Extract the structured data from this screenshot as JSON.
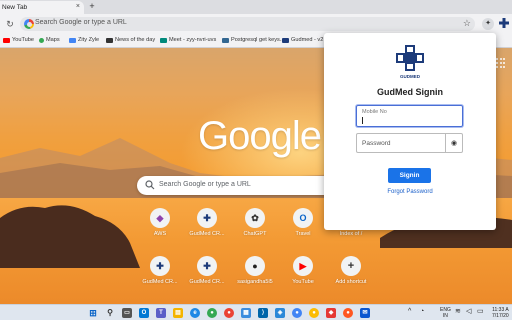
{
  "browser": {
    "tab_title": "New Tab",
    "tab_close": "×",
    "new_tab": "+",
    "omnibox_placeholder": "Search Google or type a URL",
    "bookmarks": [
      {
        "label": "YouTube",
        "color": "#ff0000"
      },
      {
        "label": "Maps",
        "color": "#34a853"
      },
      {
        "label": "Zity Zyle",
        "color": "#4285f4"
      },
      {
        "label": "News of the day",
        "color": "#333333"
      },
      {
        "label": "Meet - zyy-nvri-uvs",
        "color": "#00897b"
      },
      {
        "label": "Postgresql get keys...",
        "color": "#336791"
      },
      {
        "label": "Gudmed - v2 P...",
        "color": "#1d3b7a"
      }
    ]
  },
  "ntp": {
    "logo": "Google",
    "search_placeholder": "Search Google or type a URL",
    "shortcuts_row1": [
      {
        "label": "AWS",
        "icon": "aws-cube-icon",
        "glyph": "◆",
        "color": "#8e44ad"
      },
      {
        "label": "GudMed CR...",
        "icon": "gudmed-icon",
        "glyph": "✚",
        "color": "#1d3b7a"
      },
      {
        "label": "ChatGPT",
        "icon": "chatgpt-icon",
        "glyph": "✿",
        "color": "#333333"
      },
      {
        "label": "Travel",
        "icon": "outlook-icon",
        "glyph": "O",
        "color": "#0a64c8"
      },
      {
        "label": "Index of /",
        "icon": "web-icon",
        "glyph": "◌",
        "color": "#777777"
      }
    ],
    "shortcuts_row2": [
      {
        "label": "GudMed CR...",
        "icon": "gudmed-icon",
        "glyph": "✚",
        "color": "#1d3b7a"
      },
      {
        "label": "GudMed CR...",
        "icon": "gudmed-icon",
        "glyph": "✚",
        "color": "#1d3b7a"
      },
      {
        "label": "sasigandha5l5",
        "icon": "github-icon",
        "glyph": "●",
        "color": "#222222"
      },
      {
        "label": "YouTube",
        "icon": "youtube-icon",
        "glyph": "▶",
        "color": "#ff0000"
      },
      {
        "label": "Add shortcut",
        "icon": "plus-icon",
        "glyph": "+",
        "color": "#333333"
      }
    ]
  },
  "popup": {
    "logo_text": "GUDMED",
    "title": "GudMed Signin",
    "mobile_label": "Mobile No",
    "password_placeholder": "Password",
    "signin_label": "Signin",
    "forgot_label": "Forgot Password"
  },
  "taskbar": {
    "lang_line1": "ENG",
    "lang_line2": "IN",
    "time": "11:33 A",
    "date": "7/17/20"
  }
}
